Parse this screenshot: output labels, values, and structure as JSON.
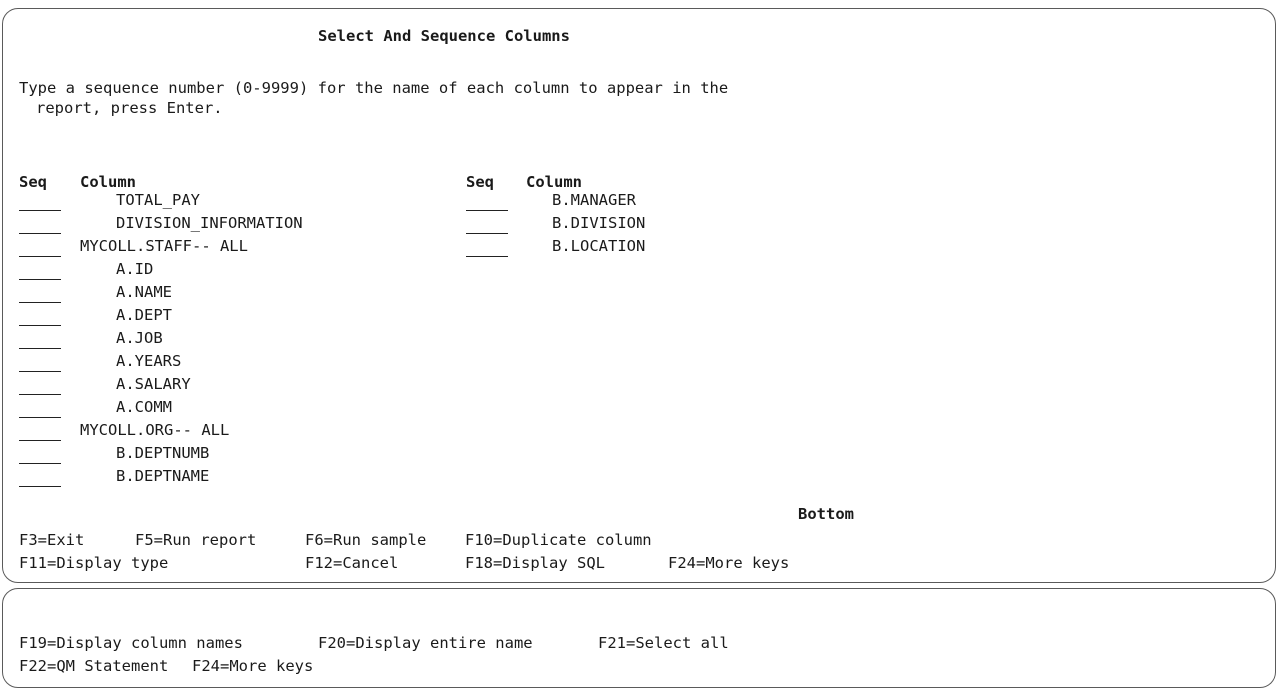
{
  "title": "Select And Sequence Columns",
  "instructions": {
    "line1": "Type a sequence number (0-9999) for the name of each column to appear in the",
    "line2": "report, press Enter."
  },
  "headers": {
    "seq": "Seq",
    "column": "Column"
  },
  "left_columns": [
    "TOTAL_PAY",
    "DIVISION_INFORMATION",
    "MYCOLL.STAFF-- ALL",
    "A.ID",
    "A.NAME",
    "A.DEPT",
    "A.JOB",
    "A.YEARS",
    "A.SALARY",
    "A.COMM",
    "MYCOLL.ORG-- ALL",
    "B.DEPTNUMB",
    "B.DEPTNAME"
  ],
  "right_columns": [
    "B.MANAGER",
    "B.DIVISION",
    "B.LOCATION"
  ],
  "position_indicator": "Bottom",
  "function_keys": {
    "row1": [
      "F3=Exit",
      "F5=Run report",
      "F6=Run sample",
      "F10=Duplicate column"
    ],
    "row2": [
      "F11=Display type",
      "F12=Cancel",
      "F18=Display SQL",
      "F24=More keys"
    ]
  },
  "more_keys": {
    "row1": [
      "F19=Display column names",
      "F20=Display entire name",
      "F21=Select all"
    ],
    "row2": [
      "F22=QM Statement",
      "F24=More keys"
    ]
  }
}
